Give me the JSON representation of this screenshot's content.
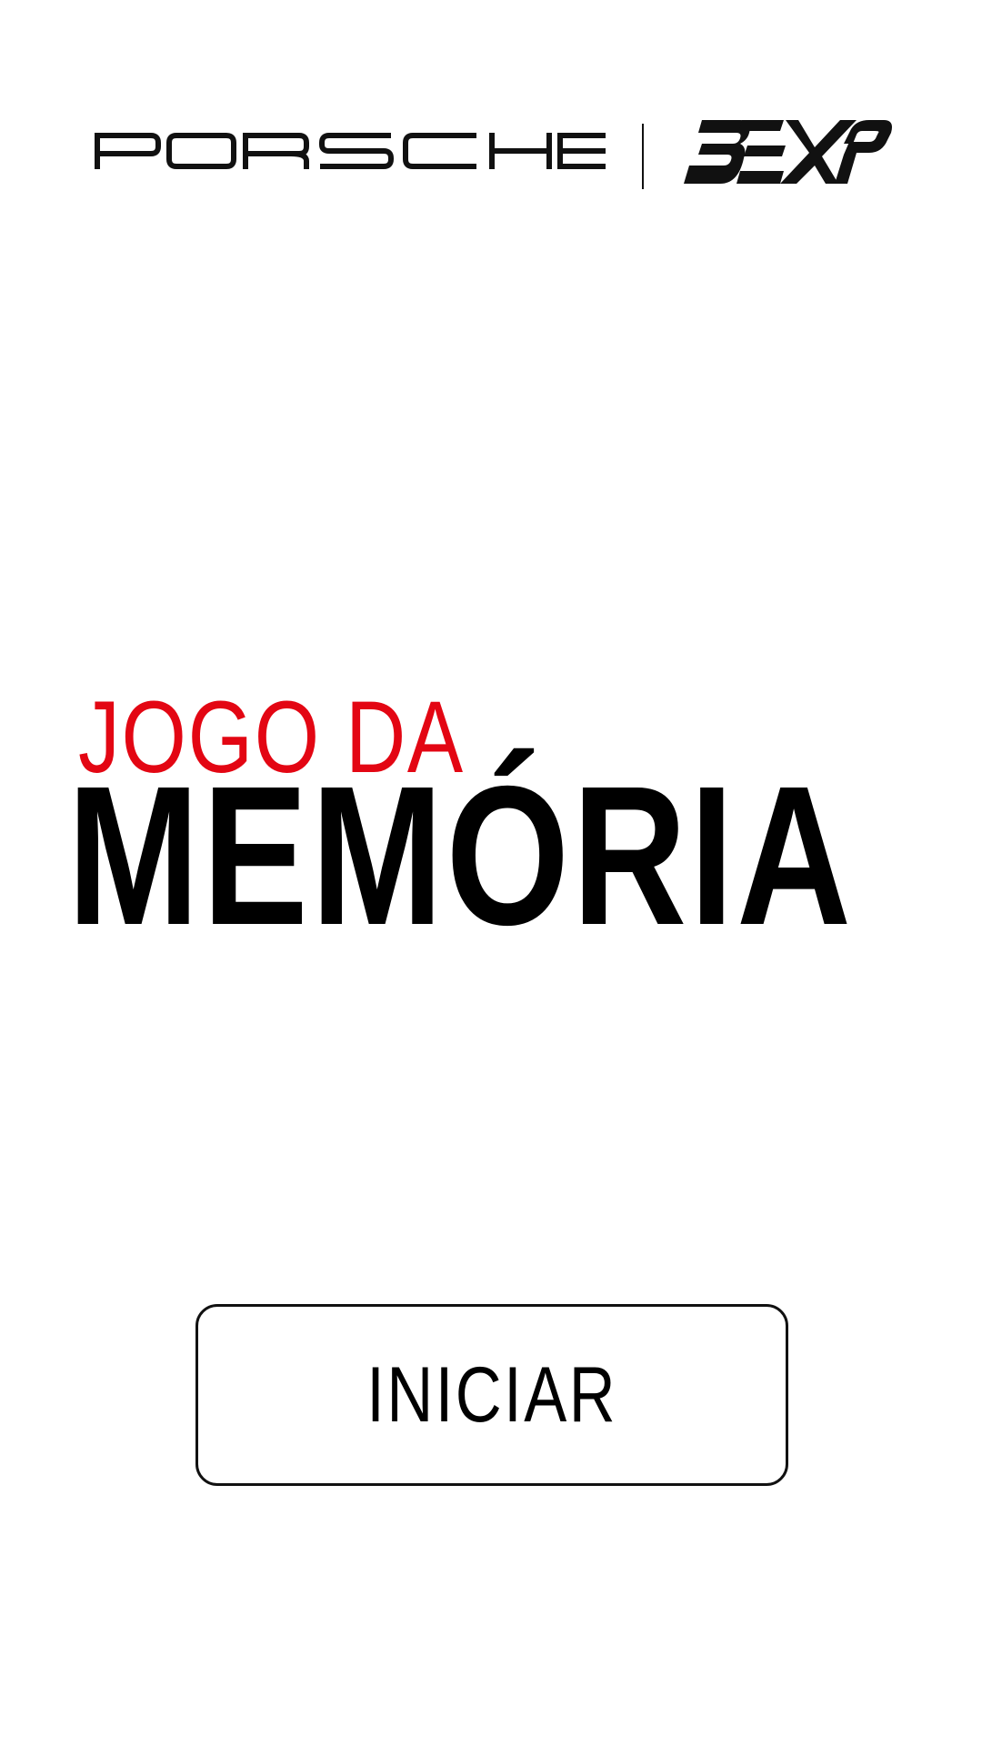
{
  "header": {
    "brand_logo": "PORSCHE",
    "partner_logo": "BEXP",
    "logo_color": "#111111"
  },
  "title": {
    "line_1": "JOGO DA",
    "line_2": "MEMÓRIA",
    "line_1_color": "#e30613",
    "line_2_color": "#000000"
  },
  "start_button": {
    "label": "INICIAR"
  }
}
